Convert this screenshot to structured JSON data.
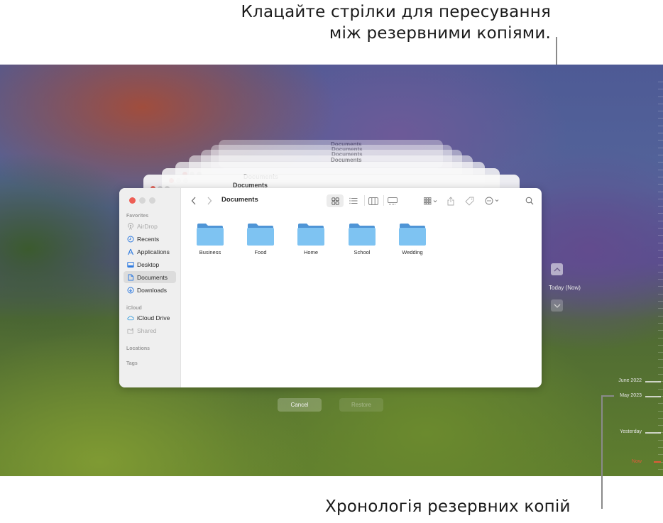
{
  "callouts": {
    "top_line1": "Клацайте стрілки для пересування",
    "top_line2": "між резервними копіями.",
    "bottom": "Хронологія резервних копій"
  },
  "finder": {
    "title": "Documents",
    "sidebar": {
      "sections": [
        {
          "label": "Favorites",
          "items": [
            {
              "label": "AirDrop",
              "icon": "airdrop-icon",
              "state": "disabled"
            },
            {
              "label": "Recents",
              "icon": "clock-icon",
              "state": "normal"
            },
            {
              "label": "Applications",
              "icon": "applications-icon",
              "state": "normal"
            },
            {
              "label": "Desktop",
              "icon": "desktop-icon",
              "state": "normal"
            },
            {
              "label": "Documents",
              "icon": "document-icon",
              "state": "selected"
            },
            {
              "label": "Downloads",
              "icon": "download-icon",
              "state": "normal"
            }
          ]
        },
        {
          "label": "iCloud",
          "items": [
            {
              "label": "iCloud Drive",
              "icon": "cloud-icon",
              "state": "normal"
            },
            {
              "label": "Shared",
              "icon": "shared-folder-icon",
              "state": "disabled"
            }
          ]
        },
        {
          "label": "Locations",
          "items": []
        },
        {
          "label": "Tags",
          "items": []
        }
      ]
    },
    "toolbar": {
      "back": "back-chevron-icon",
      "forward": "forward-chevron-icon",
      "views": [
        "icon-view-icon",
        "list-view-icon",
        "column-view-icon",
        "gallery-view-icon"
      ],
      "active_view": "icon-view-icon",
      "group": "group-icon",
      "share": "share-icon",
      "tag": "tag-icon",
      "more": "ellipsis-circle-icon",
      "search": "search-icon"
    },
    "folders": [
      "Business",
      "Food",
      "Home",
      "School",
      "Wedding"
    ],
    "folder_color": "#7ec3f2"
  },
  "ghost_windows": [
    "Documents",
    "Documents",
    "Documents",
    "Documents",
    "Documents",
    "Documents"
  ],
  "buttons": {
    "cancel": "Cancel",
    "restore": "Restore"
  },
  "navigation": {
    "current": "Today (Now)",
    "up": "up-chevron-icon",
    "down": "down-chevron-icon"
  },
  "timeline": {
    "labels": [
      "June 2022",
      "May 2023",
      "Yesterday",
      "Now"
    ],
    "now_color": "#e05a3a"
  }
}
